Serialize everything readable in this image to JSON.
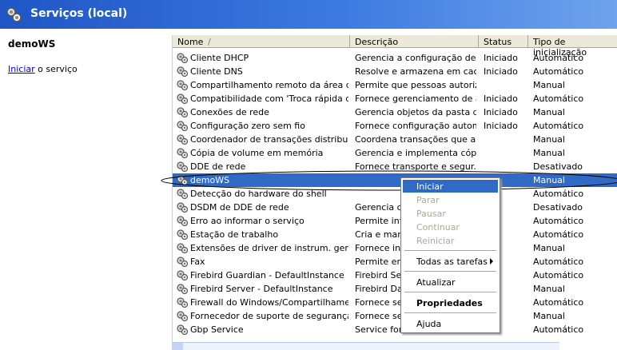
{
  "header": {
    "title": "Serviços (local)"
  },
  "left": {
    "service_name": "demoWS",
    "action_link": "Iniciar",
    "action_rest": " o serviço"
  },
  "columns": [
    {
      "label": "Nome"
    },
    {
      "label": "Descrição"
    },
    {
      "label": "Status"
    },
    {
      "label": "Tipo de inicialização"
    }
  ],
  "rows": [
    {
      "name": "Cliente DHCP",
      "desc": "Gerencia a configuração de ...",
      "status": "Iniciado",
      "type": "Automático"
    },
    {
      "name": "Cliente DNS",
      "desc": "Resolve e armazena em cac...",
      "status": "Iniciado",
      "type": "Automático"
    },
    {
      "name": "Compartilhamento remoto da área de t...",
      "desc": "Permite que pessoas autoriz...",
      "status": "",
      "type": "Manual"
    },
    {
      "name": "Compatibilidade com 'Troca rápida de u...",
      "desc": "Fornece gerenciamento de a...",
      "status": "Iniciado",
      "type": "Automático"
    },
    {
      "name": "Conexões de rede",
      "desc": "Gerencia objetos da pasta d...",
      "status": "Iniciado",
      "type": "Manual"
    },
    {
      "name": "Configuração zero sem fio",
      "desc": "Fornece configuração autom...",
      "status": "Iniciado",
      "type": "Automático"
    },
    {
      "name": "Coordenador de transações distribuídas",
      "desc": "Coordena transações que a...",
      "status": "",
      "type": "Manual"
    },
    {
      "name": "Cópia de volume em memória",
      "desc": "Gerencia e implementa cópia...",
      "status": "",
      "type": "Manual"
    },
    {
      "name": "DDE de rede",
      "desc": "Fornece transporte e segur...",
      "status": "",
      "type": "Desativado"
    },
    {
      "name": "demoWS",
      "desc": "",
      "status": "",
      "type": "Manual"
    },
    {
      "name": "Detecção do hardware do shell",
      "desc": "",
      "status": "",
      "type": "Automático"
    },
    {
      "name": "DSDM de DDE de rede",
      "desc": "Gerencia con",
      "status": "",
      "type": "Desativado"
    },
    {
      "name": "Erro ao informar o serviço",
      "desc": "Permite info",
      "status": "",
      "type": "Automático"
    },
    {
      "name": "Estação de trabalho",
      "desc": "Cria e mante",
      "status": "",
      "type": "Automático"
    },
    {
      "name": "Extensões de driver de instrum. geren...",
      "desc": "Fornece info",
      "status": "",
      "type": "Manual"
    },
    {
      "name": "Fax",
      "desc": "Permite env",
      "status": "",
      "type": "Automático"
    },
    {
      "name": "Firebird Guardian - DefaultInstance",
      "desc": "Firebird Serv",
      "status": "",
      "type": "Automático"
    },
    {
      "name": "Firebird Server - DefaultInstance",
      "desc": "Firebird Data",
      "status": "",
      "type": "Manual"
    },
    {
      "name": "Firewall do Windows/Compartilhament...",
      "desc": "Fornece ser",
      "status": "",
      "type": "Automático"
    },
    {
      "name": "Fornecedor de suporte de segurança ...",
      "desc": "Fornece seg",
      "status": "",
      "type": "Manual"
    },
    {
      "name": "Gbp Service",
      "desc": "Service for C",
      "status": "",
      "type": "Automático"
    }
  ],
  "context_menu": {
    "start": "Iniciar",
    "stop": "Parar",
    "pause": "Pausar",
    "resume": "Continuar",
    "restart": "Reiniciar",
    "all_tasks": "Todas as tarefas",
    "refresh": "Atualizar",
    "properties": "Propriedades",
    "help": "Ajuda"
  }
}
